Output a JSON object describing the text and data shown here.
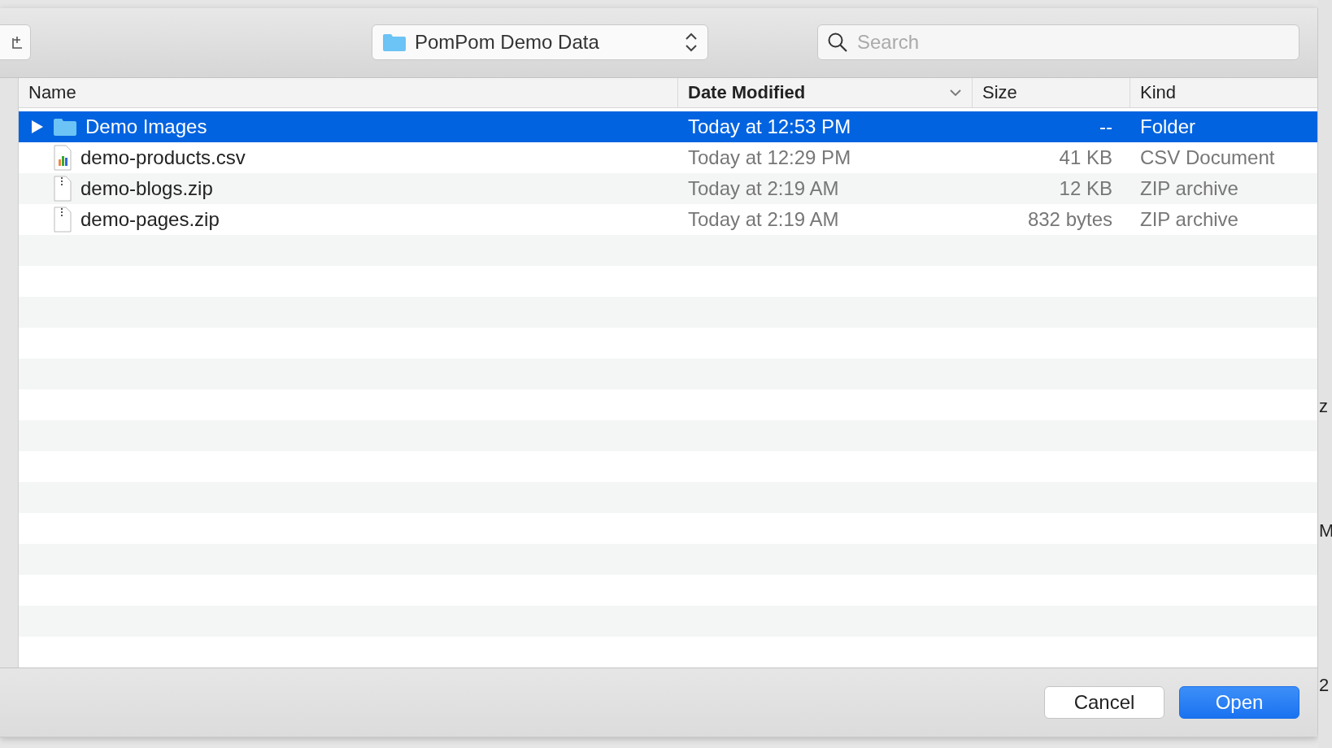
{
  "toolbar": {
    "location": "PomPom Demo Data",
    "search": {
      "placeholder": "Search"
    }
  },
  "table": {
    "columns": [
      {
        "label": "Name",
        "sorted": false
      },
      {
        "label": "Date Modified",
        "sorted": true
      },
      {
        "label": "Size",
        "sorted": false
      },
      {
        "label": "Kind",
        "sorted": false
      }
    ],
    "rows": [
      {
        "kind": "folder",
        "name": "Demo Images",
        "date": "Today at 12:53 PM",
        "size": "--",
        "type": "Folder",
        "selected": true,
        "expanded": false
      },
      {
        "kind": "csv",
        "name": "demo-products.csv",
        "date": "Today at 12:29 PM",
        "size": "41 KB",
        "type": "CSV Document",
        "selected": false
      },
      {
        "kind": "zip",
        "name": "demo-blogs.zip",
        "date": "Today at 2:19 AM",
        "size": "12 KB",
        "type": "ZIP archive",
        "selected": false
      },
      {
        "kind": "zip",
        "name": "demo-pages.zip",
        "date": "Today at 2:19 AM",
        "size": "832 bytes",
        "type": "ZIP archive",
        "selected": false
      }
    ]
  },
  "buttons": [
    {
      "label": "Cancel",
      "default": false
    },
    {
      "label": "Open",
      "default": true
    }
  ],
  "background_fragments": [
    "z",
    "M",
    "2"
  ]
}
